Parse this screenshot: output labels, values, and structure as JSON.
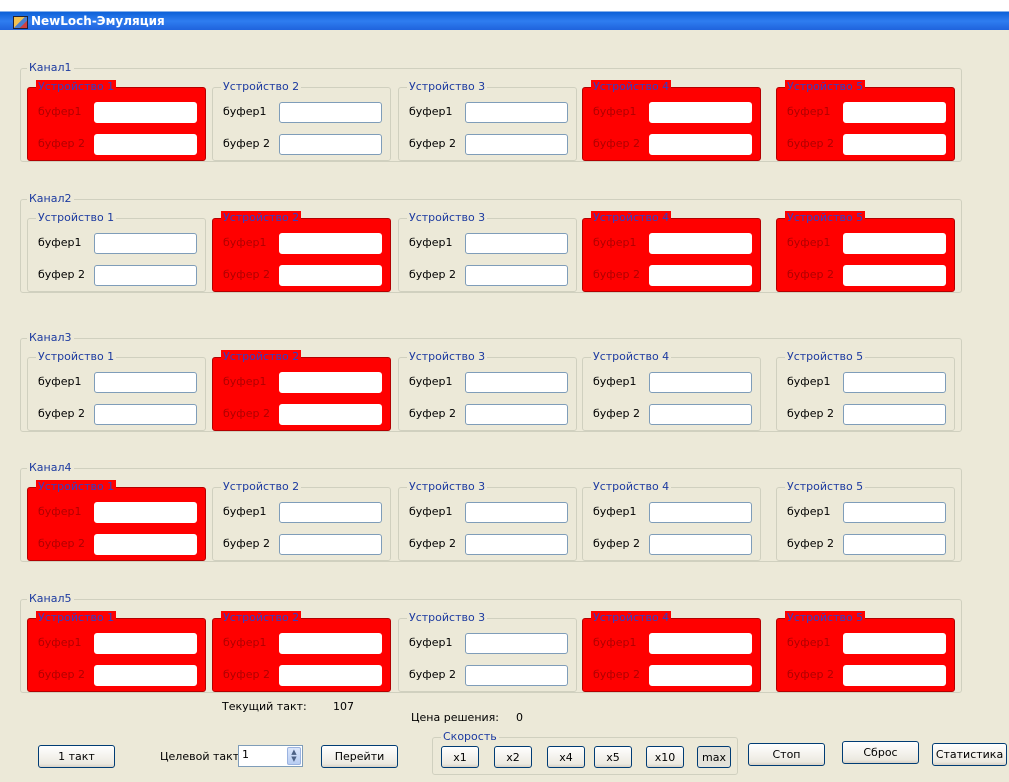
{
  "window": {
    "title": "NewLoch-Эмуляция",
    "icon": "app-window-icon"
  },
  "colors": {
    "busy": "#ff0000",
    "free": "#ece9d8",
    "label": "#1c3aa0"
  },
  "channels": [
    {
      "label": "Канал1",
      "devices": [
        {
          "label": "Устройство 1",
          "busy": true,
          "buffers": [
            "буфер1",
            "буфер 2"
          ]
        },
        {
          "label": "Устройство 2",
          "busy": false,
          "buffers": [
            "буфер1",
            "буфер 2"
          ]
        },
        {
          "label": "Устройство 3",
          "busy": false,
          "buffers": [
            "буфер1",
            "буфер 2"
          ]
        },
        {
          "label": "Устройство 4",
          "busy": true,
          "buffers": [
            "буфер1",
            "буфер 2"
          ]
        },
        {
          "label": "Устройство 5",
          "busy": true,
          "buffers": [
            "буфер1",
            "буфер 2"
          ]
        }
      ]
    },
    {
      "label": "Канал2",
      "devices": [
        {
          "label": "Устройство 1",
          "busy": false,
          "buffers": [
            "буфер1",
            "буфер 2"
          ]
        },
        {
          "label": "Устройство 2",
          "busy": true,
          "buffers": [
            "буфер1",
            "буфер 2"
          ]
        },
        {
          "label": "Устройство 3",
          "busy": false,
          "buffers": [
            "буфер1",
            "буфер 2"
          ]
        },
        {
          "label": "Устройство 4",
          "busy": true,
          "buffers": [
            "буфер1",
            "буфер 2"
          ]
        },
        {
          "label": "Устройство 5",
          "busy": true,
          "buffers": [
            "буфер1",
            "буфер 2"
          ]
        }
      ]
    },
    {
      "label": "Канал3",
      "devices": [
        {
          "label": "Устройство 1",
          "busy": false,
          "buffers": [
            "буфер1",
            "буфер 2"
          ]
        },
        {
          "label": "Устройство 2",
          "busy": true,
          "buffers": [
            "буфер1",
            "буфер 2"
          ]
        },
        {
          "label": "Устройство 3",
          "busy": false,
          "buffers": [
            "буфер1",
            "буфер 2"
          ]
        },
        {
          "label": "Устройство 4",
          "busy": false,
          "buffers": [
            "буфер1",
            "буфер 2"
          ]
        },
        {
          "label": "Устройство 5",
          "busy": false,
          "buffers": [
            "буфер1",
            "буфер 2"
          ]
        }
      ]
    },
    {
      "label": "Канал4",
      "devices": [
        {
          "label": "Устройство 1",
          "busy": true,
          "buffers": [
            "буфер1",
            "буфер 2"
          ]
        },
        {
          "label": "Устройство 2",
          "busy": false,
          "buffers": [
            "буфер1",
            "буфер 2"
          ]
        },
        {
          "label": "Устройство 3",
          "busy": false,
          "buffers": [
            "буфер1",
            "буфер 2"
          ]
        },
        {
          "label": "Устройство 4",
          "busy": false,
          "buffers": [
            "буфер1",
            "буфер 2"
          ]
        },
        {
          "label": "Устройство 5",
          "busy": false,
          "buffers": [
            "буфер1",
            "буфер 2"
          ]
        }
      ]
    },
    {
      "label": "Канал5",
      "devices": [
        {
          "label": "Устройство 1",
          "busy": true,
          "buffers": [
            "буфер1",
            "буфер 2"
          ]
        },
        {
          "label": "Устройство 2",
          "busy": true,
          "buffers": [
            "буфер1",
            "буфер 2"
          ]
        },
        {
          "label": "Устройство 3",
          "busy": false,
          "buffers": [
            "буфер1",
            "буфер 2"
          ]
        },
        {
          "label": "Устройство 4",
          "busy": true,
          "buffers": [
            "буфер1",
            "буфер 2"
          ]
        },
        {
          "label": "Устройство 5",
          "busy": true,
          "buffers": [
            "буфер1",
            "буфер 2"
          ]
        }
      ]
    }
  ],
  "status": {
    "current_tick_label": "Текущий такт:",
    "current_tick_value": "107",
    "cost_label": "Цена решения:",
    "cost_value": "0"
  },
  "controls": {
    "step_button": "1 такт",
    "target_tick_label": "Целевой такт",
    "target_tick_value": "1",
    "go_button": "Перейти",
    "speed_label": "Скорость",
    "speed_buttons": [
      "x1",
      "x2",
      "x4",
      "x5",
      "x10",
      "max"
    ],
    "speed_selected": "max",
    "stop_button": "Стоп",
    "reset_button": "Сброс",
    "stats_button": "Статистика"
  }
}
